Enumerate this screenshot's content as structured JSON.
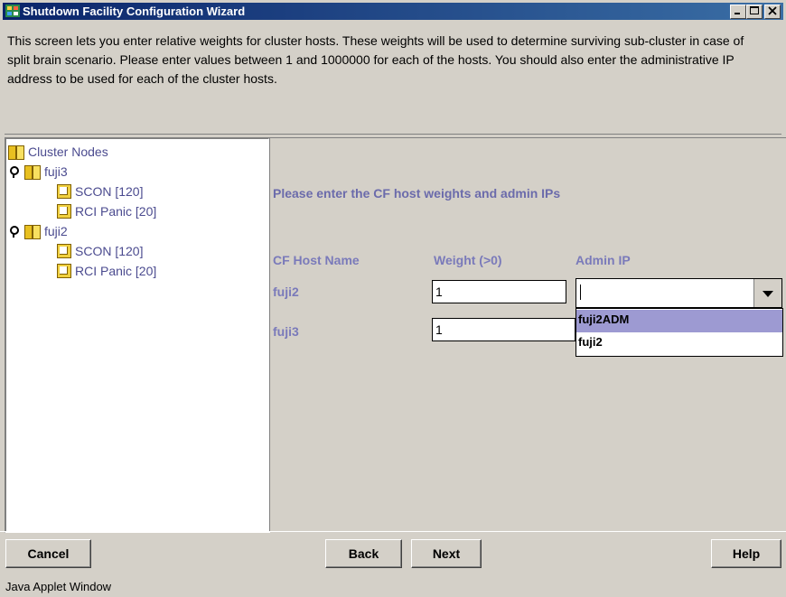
{
  "window": {
    "title": "Shutdown Facility Configuration Wizard",
    "minimize_label": "_",
    "maximize_label": "□",
    "close_label": "×"
  },
  "description": "This screen lets you enter relative weights for cluster hosts. These weights will be used to determine surviving sub-cluster in case of split brain scenario. Please enter values between 1 and 1000000 for each of the hosts. You should also enter the administrative IP address to be used for each of the cluster hosts.",
  "tree": {
    "root": "Cluster Nodes",
    "nodes": [
      {
        "label": "fuji3",
        "children": [
          "SCON [120]",
          "RCI Panic [20]"
        ]
      },
      {
        "label": "fuji2",
        "children": [
          "SCON [120]",
          "RCI Panic [20]"
        ]
      }
    ]
  },
  "form": {
    "heading": "Please enter the CF host weights and admin IPs",
    "columns": {
      "host": "CF Host Name",
      "weight": "Weight (>0)",
      "admin_ip": "Admin IP"
    },
    "rows": [
      {
        "host": "fuji2",
        "weight": "1",
        "admin_ip": ""
      },
      {
        "host": "fuji3",
        "weight": "1"
      }
    ],
    "dropdown_options": [
      "fuji2ADM",
      "fuji2"
    ],
    "dropdown_selected": "fuji2ADM"
  },
  "buttons": {
    "cancel": "Cancel",
    "back": "Back",
    "next": "Next",
    "help": "Help"
  },
  "status": "Java Applet Window",
  "colors": {
    "titlebar": "#0a246a",
    "label": "#7a7aba",
    "selection": "#9d9ad2",
    "background": "#d4d0c8"
  }
}
